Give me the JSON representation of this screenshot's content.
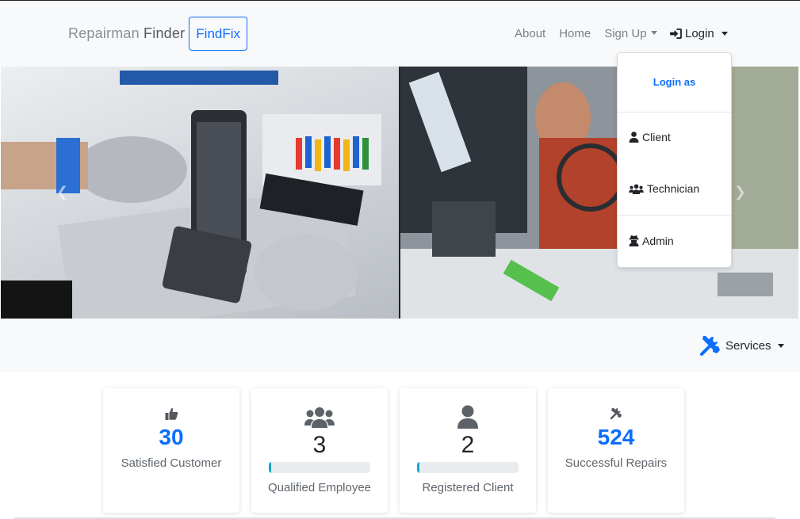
{
  "brand": {
    "name_light": "Repairman",
    "name_dark": "Finder",
    "badge": "FindFix"
  },
  "nav": {
    "about": "About",
    "home": "Home",
    "signup": "Sign Up",
    "login": "Login"
  },
  "login_dropdown": {
    "header": "Login as",
    "items": [
      {
        "label": "Client",
        "icon": "user-icon"
      },
      {
        "label": "Technician",
        "icon": "users-icon"
      },
      {
        "label": "Admin",
        "icon": "user-secret-icon"
      }
    ]
  },
  "services": {
    "label": "Services",
    "icon": "tools-icon"
  },
  "stats": [
    {
      "value": "30",
      "label": "Satisfied Customer",
      "icon": "thumbs-up-icon",
      "color": "#0d6efd"
    },
    {
      "value": "3",
      "label": "Qualified Employee",
      "icon": "users-icon",
      "progress": 0.02
    },
    {
      "value": "2",
      "label": "Registered Client",
      "icon": "user-icon",
      "progress": 0.02
    },
    {
      "value": "524",
      "label": "Successful Repairs",
      "icon": "tools-icon",
      "color": "#0d6efd"
    }
  ],
  "colors": {
    "accent": "#0d6efd",
    "progress": "#1aa6c9",
    "navbar_bg": "#f8f9fa"
  }
}
